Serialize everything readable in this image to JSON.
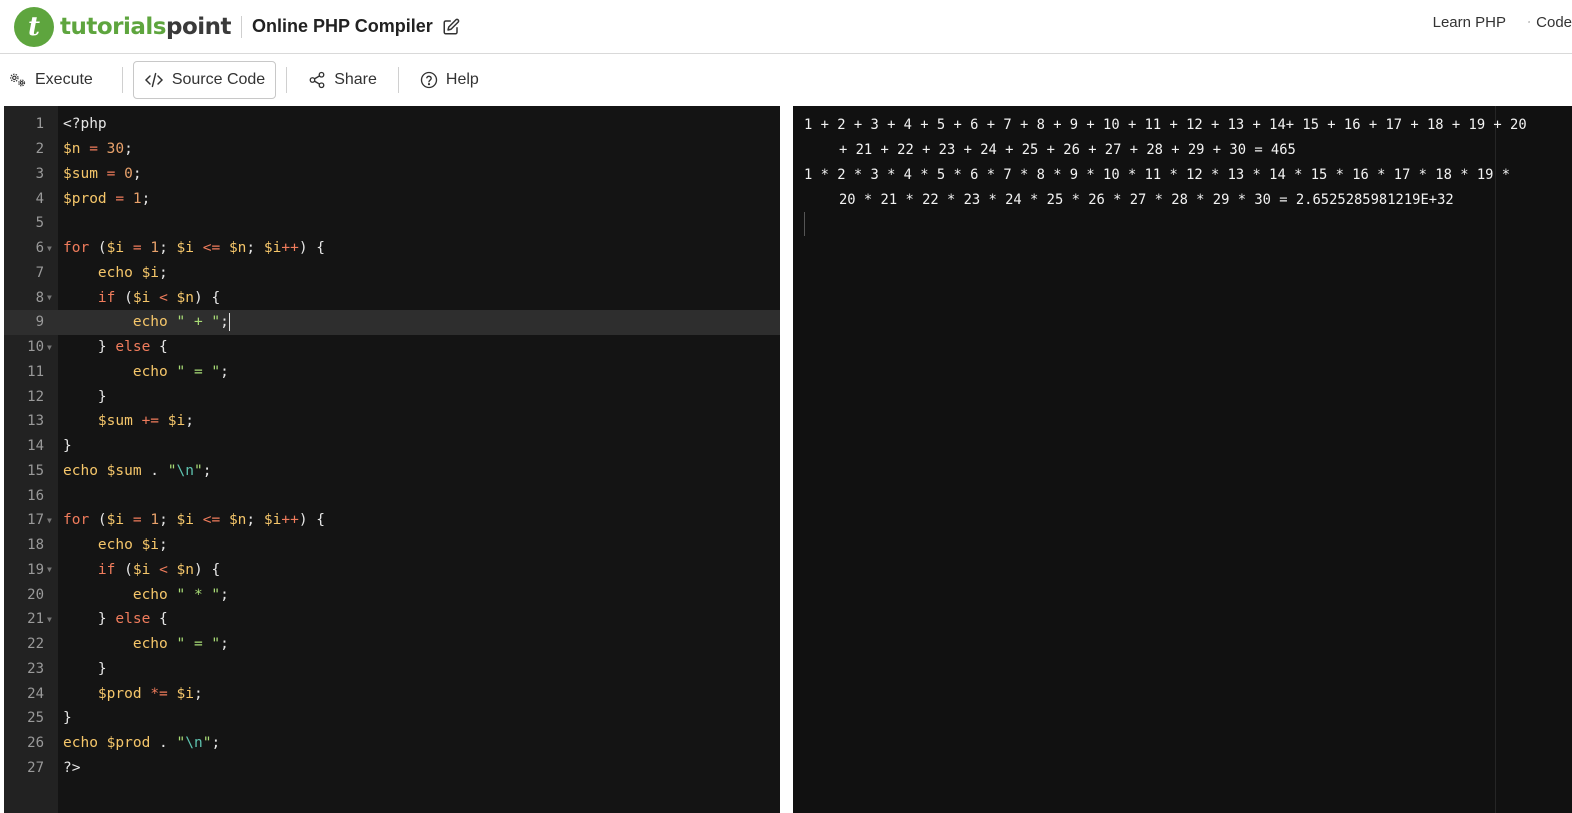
{
  "header": {
    "logo_part1": "tutorials",
    "logo_part2": "point",
    "title": "Online PHP Compiler",
    "learn_link": "Learn PHP",
    "settings_label": "Code"
  },
  "toolbar": {
    "execute": "Execute",
    "source_code": "Source Code",
    "share": "Share",
    "help": "Help"
  },
  "editor": {
    "lines": [
      "1",
      "2",
      "3",
      "4",
      "5",
      "6",
      "7",
      "8",
      "9",
      "10",
      "11",
      "12",
      "13",
      "14",
      "15",
      "16",
      "17",
      "18",
      "19",
      "20",
      "21",
      "22",
      "23",
      "24",
      "25",
      "26",
      "27"
    ],
    "active_line": 9
  },
  "output": {
    "lines": [
      "1 + 2 + 3 + 4 + 5 + 6 + 7 + 8 + 9 + 10 + 11 + 12 + 13 + 14+ 15 + 16 + 17 + 18 + 19 + 20",
      "+ 21 + 22 + 23 + 24 + 25 + 26 + 27 + 28 + 29 + 30 = 465",
      "1 * 2 * 3 * 4 * 5 * 6 * 7 * 8 * 9 * 10 * 11 * 12 * 13 * 14 * 15 * 16 * 17 * 18 * 19 *",
      "20 * 21 * 22 * 23 * 24 * 25 * 26 * 27 * 28 * 29 * 30 = 2.6525285981219E+32"
    ]
  },
  "colors": {
    "brand_green": "#5ea53e",
    "editor_bg": "#141414",
    "keyword": "#f07c5c",
    "variable": "#f5c66a",
    "string": "#a9dc76"
  }
}
